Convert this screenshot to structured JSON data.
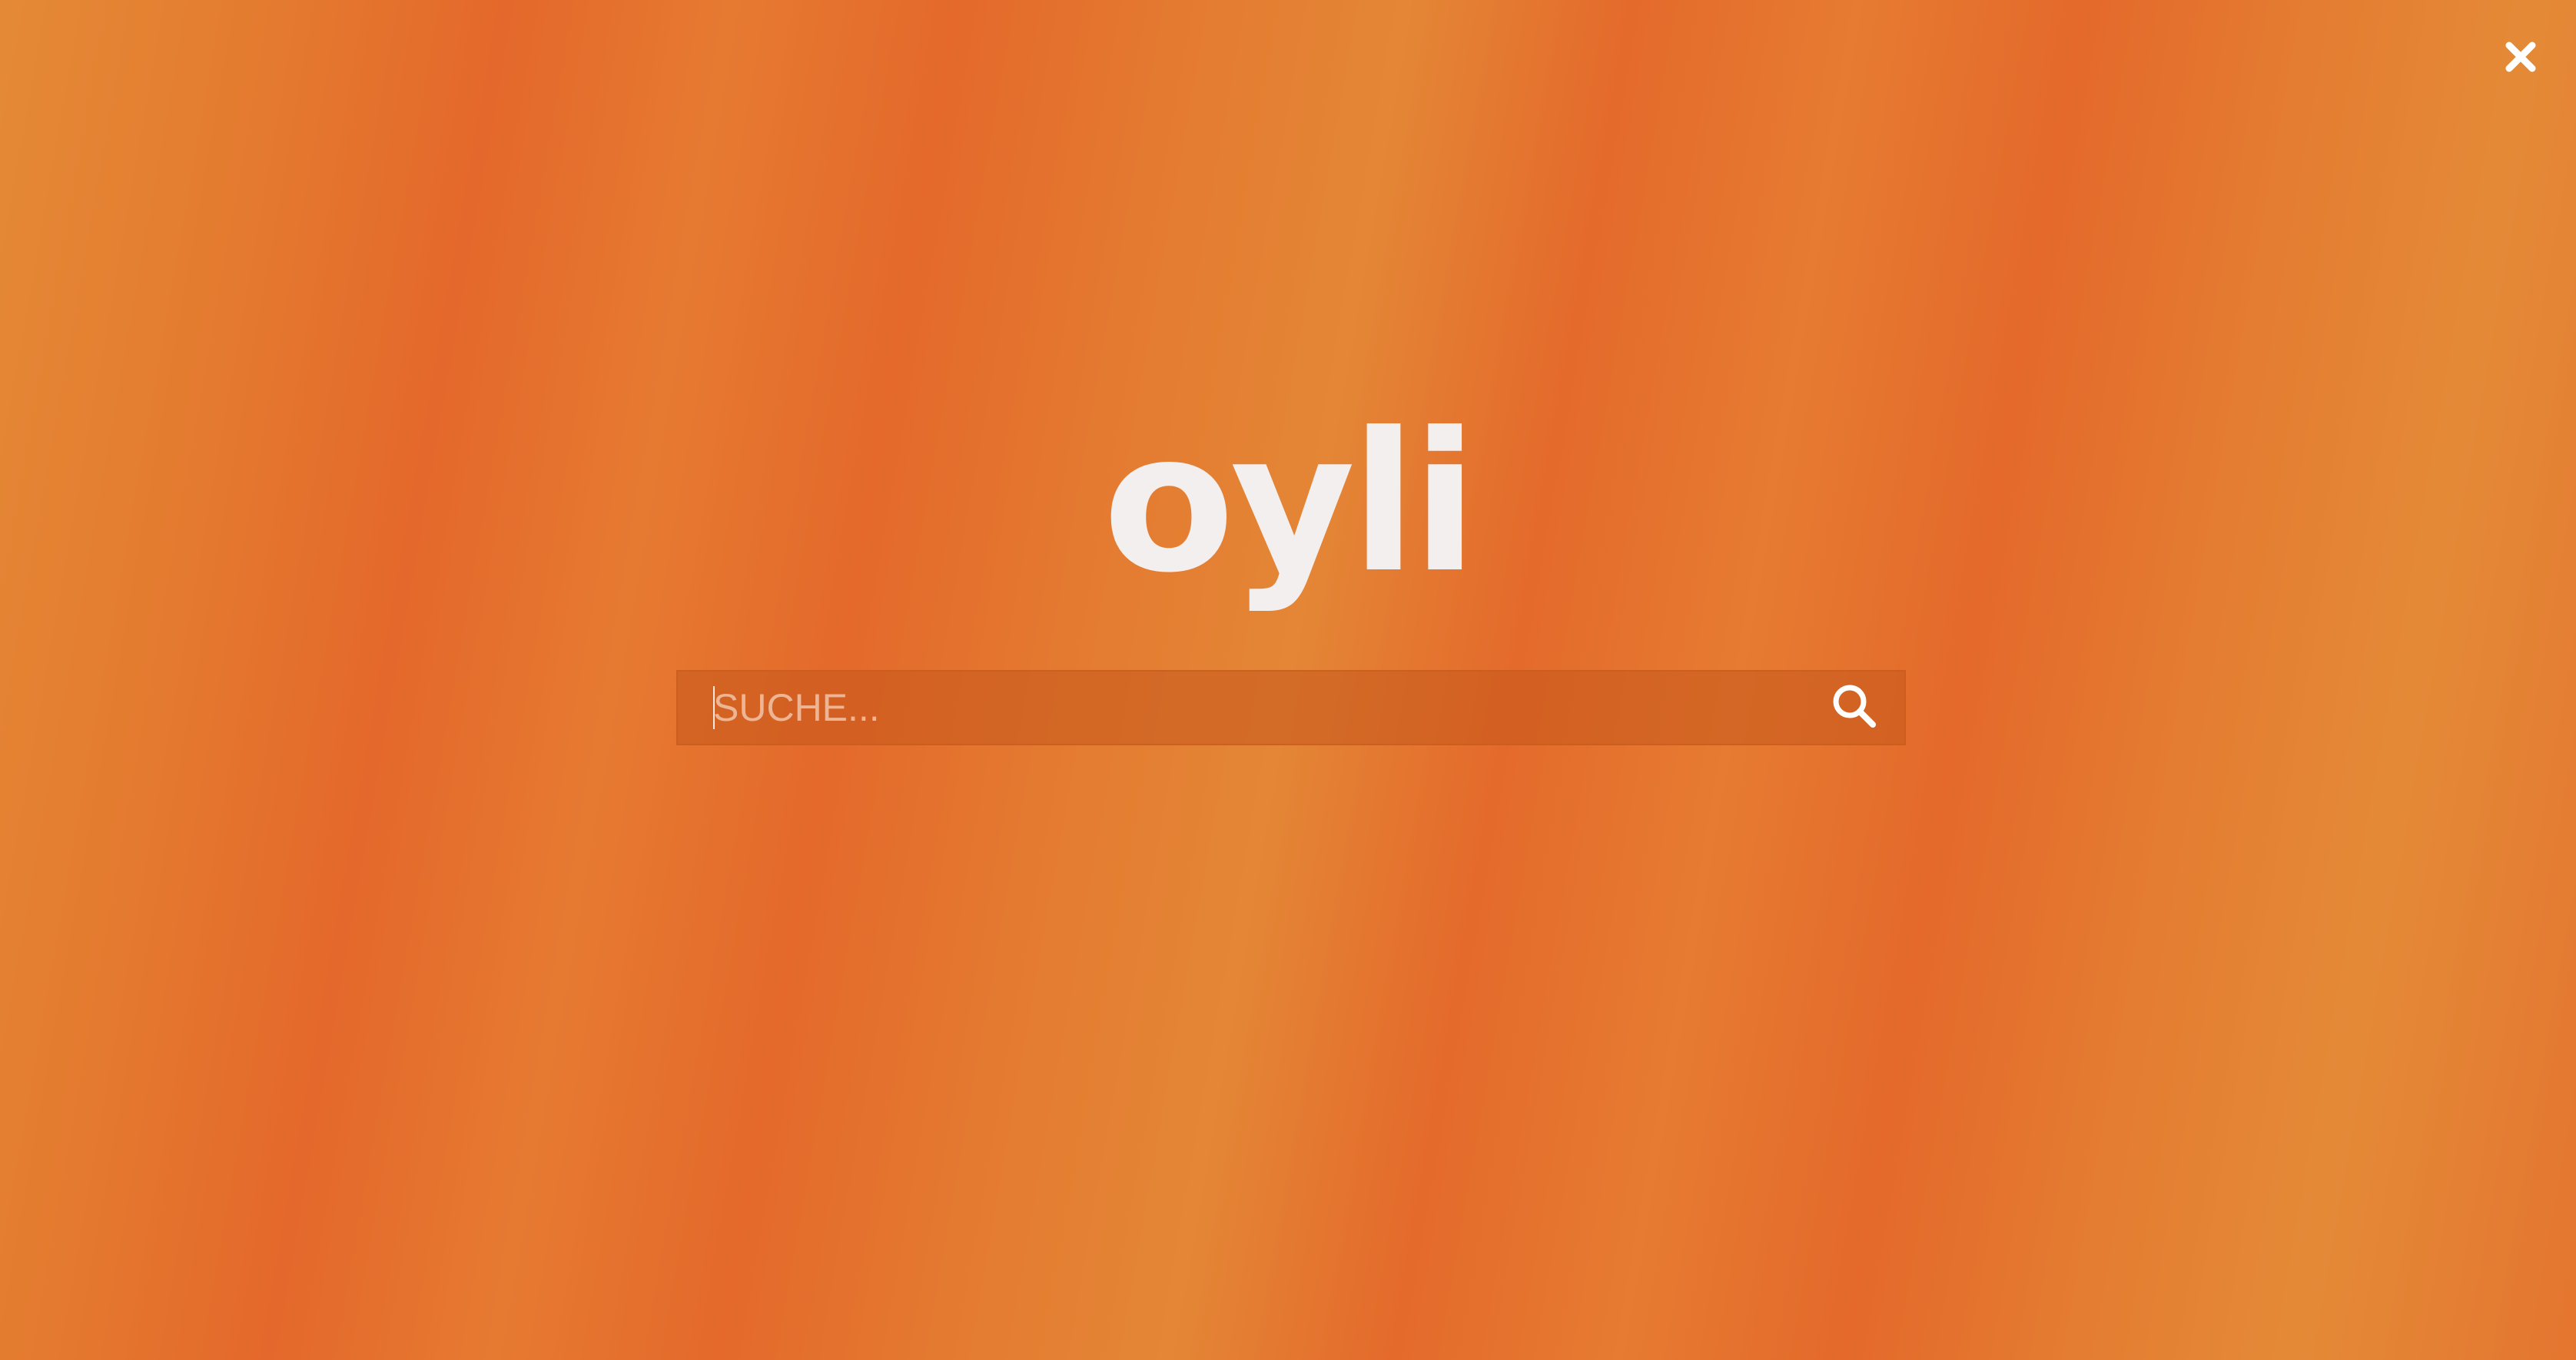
{
  "logo": {
    "text": "oyli"
  },
  "search": {
    "placeholder": "SUCHE...",
    "value": ""
  },
  "icons": {
    "close": "close-icon",
    "search": "search-icon"
  },
  "colors": {
    "background": "#e47330",
    "logo": "#f4efef",
    "search_box": "#d0622a"
  }
}
